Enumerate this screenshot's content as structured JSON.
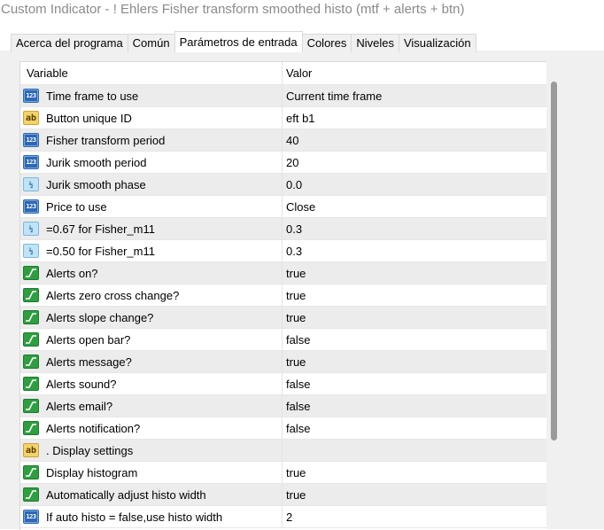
{
  "window": {
    "title": "Custom Indicator - ! Ehlers Fisher transform smoothed histo (mtf + alerts + btn)"
  },
  "tabs": [
    {
      "label": "Acerca del programa",
      "active": false
    },
    {
      "label": "Común",
      "active": false
    },
    {
      "label": "Parámetros de entrada",
      "active": true
    },
    {
      "label": "Colores",
      "active": false
    },
    {
      "label": "Niveles",
      "active": false
    },
    {
      "label": "Visualización",
      "active": false
    }
  ],
  "table": {
    "headers": {
      "variable": "Variable",
      "value": "Valor"
    },
    "rows": [
      {
        "icon": "int",
        "variable": "Time frame to use",
        "value": "Current time frame"
      },
      {
        "icon": "string",
        "variable": "Button unique ID",
        "value": "eft b1"
      },
      {
        "icon": "int",
        "variable": "Fisher transform period",
        "value": "40"
      },
      {
        "icon": "int",
        "variable": "Jurik smooth period",
        "value": "20"
      },
      {
        "icon": "double",
        "variable": "Jurik smooth phase",
        "value": "0.0"
      },
      {
        "icon": "int",
        "variable": "Price to use",
        "value": "Close"
      },
      {
        "icon": "double",
        "variable": "=0.67 for Fisher_m11",
        "value": "0.3"
      },
      {
        "icon": "double",
        "variable": "=0.50 for Fisher_m11",
        "value": "0.3"
      },
      {
        "icon": "bool",
        "variable": "Alerts on?",
        "value": "true"
      },
      {
        "icon": "bool",
        "variable": "Alerts zero cross change?",
        "value": "true"
      },
      {
        "icon": "bool",
        "variable": "Alerts slope change?",
        "value": "true"
      },
      {
        "icon": "bool",
        "variable": "Alerts open bar?",
        "value": "false"
      },
      {
        "icon": "bool",
        "variable": "Alerts message?",
        "value": "true"
      },
      {
        "icon": "bool",
        "variable": "Alerts sound?",
        "value": "false"
      },
      {
        "icon": "bool",
        "variable": "Alerts email?",
        "value": "false"
      },
      {
        "icon": "bool",
        "variable": "Alerts notification?",
        "value": "false"
      },
      {
        "icon": "string",
        "variable": ". Display settings",
        "value": ""
      },
      {
        "icon": "bool",
        "variable": "Display histogram",
        "value": "true"
      },
      {
        "icon": "bool",
        "variable": "Automatically adjust histo width",
        "value": "true"
      },
      {
        "icon": "int",
        "variable": "If auto histo = false,use histo width",
        "value": "2"
      }
    ]
  },
  "icon_glyphs": {
    "int": "123",
    "string": "ab",
    "double": "½"
  }
}
